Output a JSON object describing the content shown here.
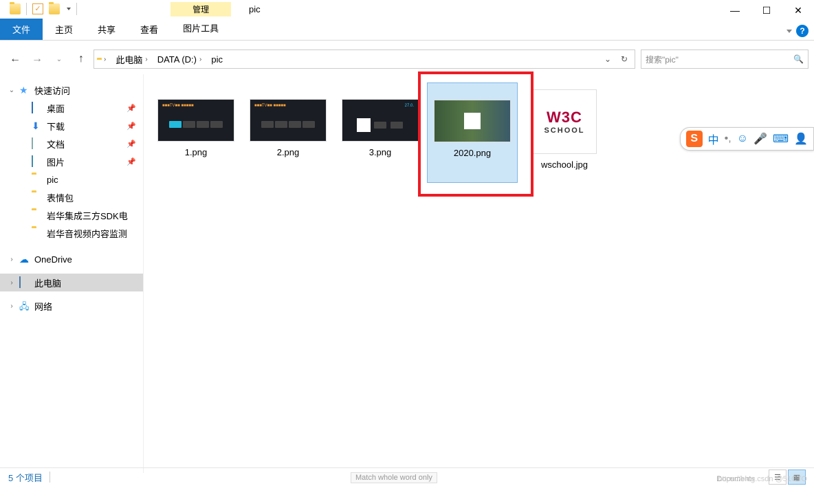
{
  "window": {
    "title": "pic",
    "ctx_group_label": "管理",
    "ctx_tab": "图片工具"
  },
  "tabs": {
    "file": "文件",
    "home": "主页",
    "share": "共享",
    "view": "查看"
  },
  "nav": {
    "back": "←",
    "forward": "→",
    "up": "↑"
  },
  "breadcrumb": [
    "此电脑",
    "DATA (D:)",
    "pic"
  ],
  "search": {
    "placeholder": "搜索\"pic\""
  },
  "sidebar": {
    "quick_access": "快速访问",
    "items": [
      {
        "label": "桌面",
        "pinned": true,
        "ico": "desktop"
      },
      {
        "label": "下载",
        "pinned": true,
        "ico": "download"
      },
      {
        "label": "文档",
        "pinned": true,
        "ico": "doc"
      },
      {
        "label": "图片",
        "pinned": true,
        "ico": "picture"
      },
      {
        "label": "pic",
        "pinned": false,
        "ico": "folder"
      },
      {
        "label": "表情包",
        "pinned": false,
        "ico": "folder"
      },
      {
        "label": "岩华集成三方SDK电",
        "pinned": false,
        "ico": "folder"
      },
      {
        "label": "岩华音视频内容监测",
        "pinned": false,
        "ico": "folder"
      }
    ],
    "onedrive": "OneDrive",
    "this_pc": "此电脑",
    "network": "网络"
  },
  "files": [
    {
      "name": "1.png",
      "kind": "dark",
      "selected": false
    },
    {
      "name": "2.png",
      "kind": "dark",
      "selected": false
    },
    {
      "name": "3.png",
      "kind": "qr",
      "selected": false
    },
    {
      "name": "2020.png",
      "kind": "blur",
      "selected": true
    },
    {
      "name": "wschool.jpg",
      "kind": "w3c",
      "selected": false
    }
  ],
  "w3c": {
    "line1": "W3C",
    "line2": "SCHOOL"
  },
  "status": {
    "count_text": "5 个项目"
  },
  "ime": {
    "lang": "中"
  },
  "fragments": {
    "match": "Match whole word only",
    "docs": "Documents"
  },
  "watermark": "https://blog.csdn @51CTO"
}
